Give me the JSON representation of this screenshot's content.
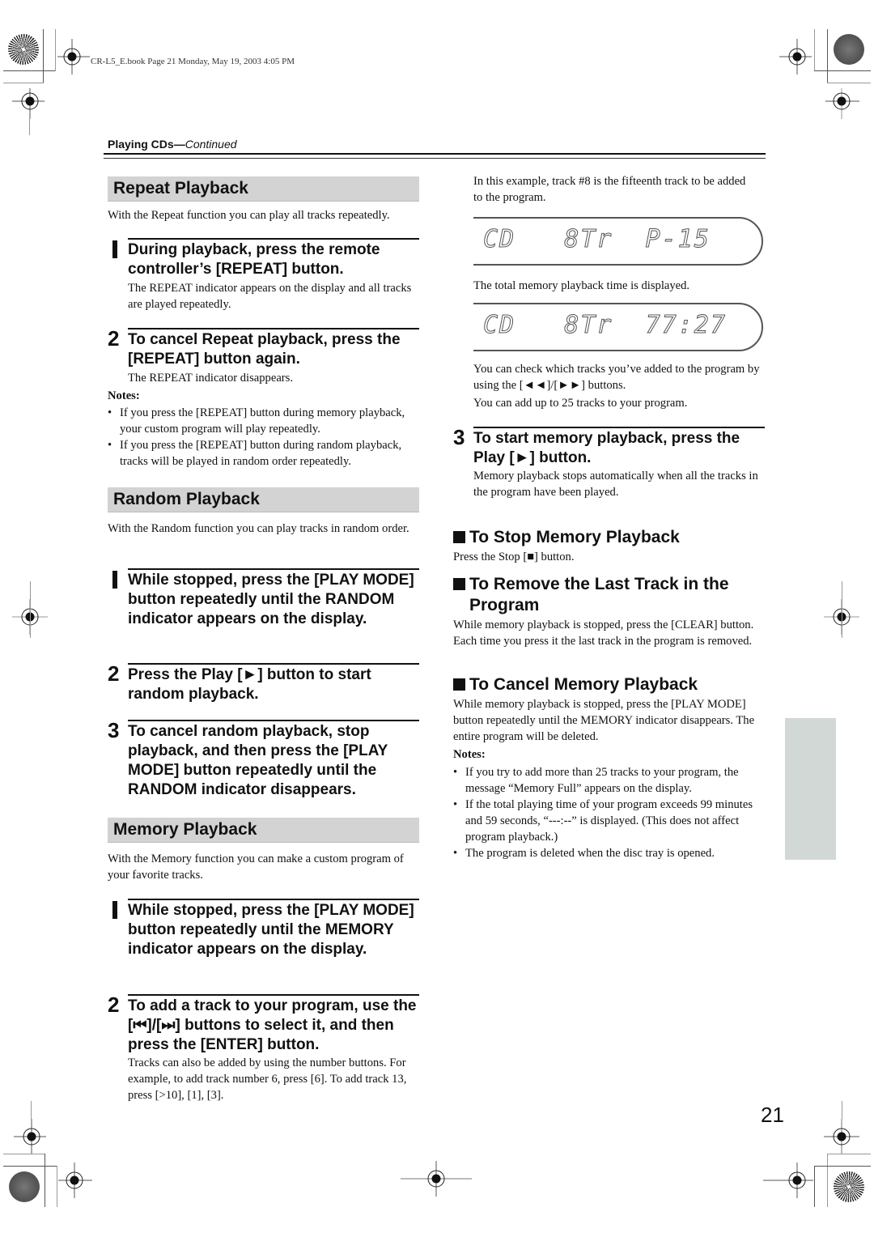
{
  "book_meta": "CR-L5_E.book  Page 21  Monday, May 19, 2003  4:05 PM",
  "running_head": {
    "title": "Playing CDs—",
    "suffix": "Continued"
  },
  "left_column": {
    "repeat": {
      "heading": "Repeat Playback",
      "intro": "With the Repeat function you can play all tracks repeatedly.",
      "steps": [
        {
          "number": "1",
          "title": "During playback, press the remote controller’s [REPEAT] button.",
          "desc": "The REPEAT indicator appears on the display and all tracks are played repeatedly."
        },
        {
          "number": "2",
          "title": "To cancel Repeat playback, press the [REPEAT] button again.",
          "desc": "The REPEAT indicator disappears."
        }
      ],
      "notes_label": "Notes:",
      "notes": [
        "If you press the [REPEAT] button during memory playback, your custom program will play repeatedly.",
        "If you press the [REPEAT] button during random playback, tracks will be played in random order repeatedly."
      ]
    },
    "random": {
      "heading": "Random Playback",
      "intro": "With the Random function you can play tracks in random order.",
      "steps": [
        {
          "number": "1",
          "title": "While stopped, press the [PLAY MODE] button repeatedly until the RANDOM indicator appears on the display."
        },
        {
          "number": "2",
          "title": "Press the Play [►] button to start random playback."
        },
        {
          "number": "3",
          "title": "To cancel random playback, stop playback, and then press the [PLAY MODE] button repeatedly until the RANDOM indicator disappears."
        }
      ]
    },
    "memory": {
      "heading": "Memory Playback",
      "intro": "With the Memory function you can make a custom program of your favorite tracks.",
      "steps": [
        {
          "number": "1",
          "title": "While stopped, press the [PLAY MODE] button repeatedly until the MEMORY indicator appears on the display."
        },
        {
          "number": "2",
          "title": "To add a track to your program, use the [⏮]/[⏭] buttons to select it, and then press the [ENTER] button.",
          "desc": "Tracks can also be added by using the number buttons. For example, to add track number 6, press [6]. To add track 13, press [>10], [1], [3]."
        }
      ]
    }
  },
  "right_column": {
    "example_text": "In this example, track #8 is the fifteenth track to be added to the program.",
    "lcd1": "CD   8Tr  P-15",
    "time_text": "The total memory playback time is displayed.",
    "lcd2": "CD   8Tr  77:27",
    "check_text": "You can check which tracks you’ve added to the program by using the [◄◄]/[►►] buttons.",
    "max_text": "You can add up to 25 tracks to your program.",
    "step3": {
      "number": "3",
      "title": "To start memory playback, press the Play [►] button.",
      "desc": "Memory playback stops automatically when all the tracks in the program have been played."
    },
    "stop": {
      "heading": "To Stop Memory Playback",
      "text": "Press the Stop [■] button."
    },
    "remove": {
      "heading": "To Remove the Last Track in the Program",
      "text": "While memory playback is stopped, press the [CLEAR] button. Each time you press it the last track in the program is removed."
    },
    "cancel": {
      "heading": "To Cancel Memory Playback",
      "text": "While memory playback is stopped, press the [PLAY MODE] button repeatedly until the MEMORY indicator disappears. The entire program will be deleted."
    },
    "notes_label": "Notes:",
    "notes": [
      "If you try to add more than 25 tracks to your program, the message “Memory Full” appears on the display.",
      "If the total playing time of your program exceeds 99 minutes and 59 seconds, “---:--” is displayed. (This does not affect program playback.)",
      "The program is deleted when the disc tray is opened."
    ]
  },
  "page_number": "21",
  "colors": {
    "banner": "#d3d3d3",
    "side_tab": "#d1d8d6"
  }
}
